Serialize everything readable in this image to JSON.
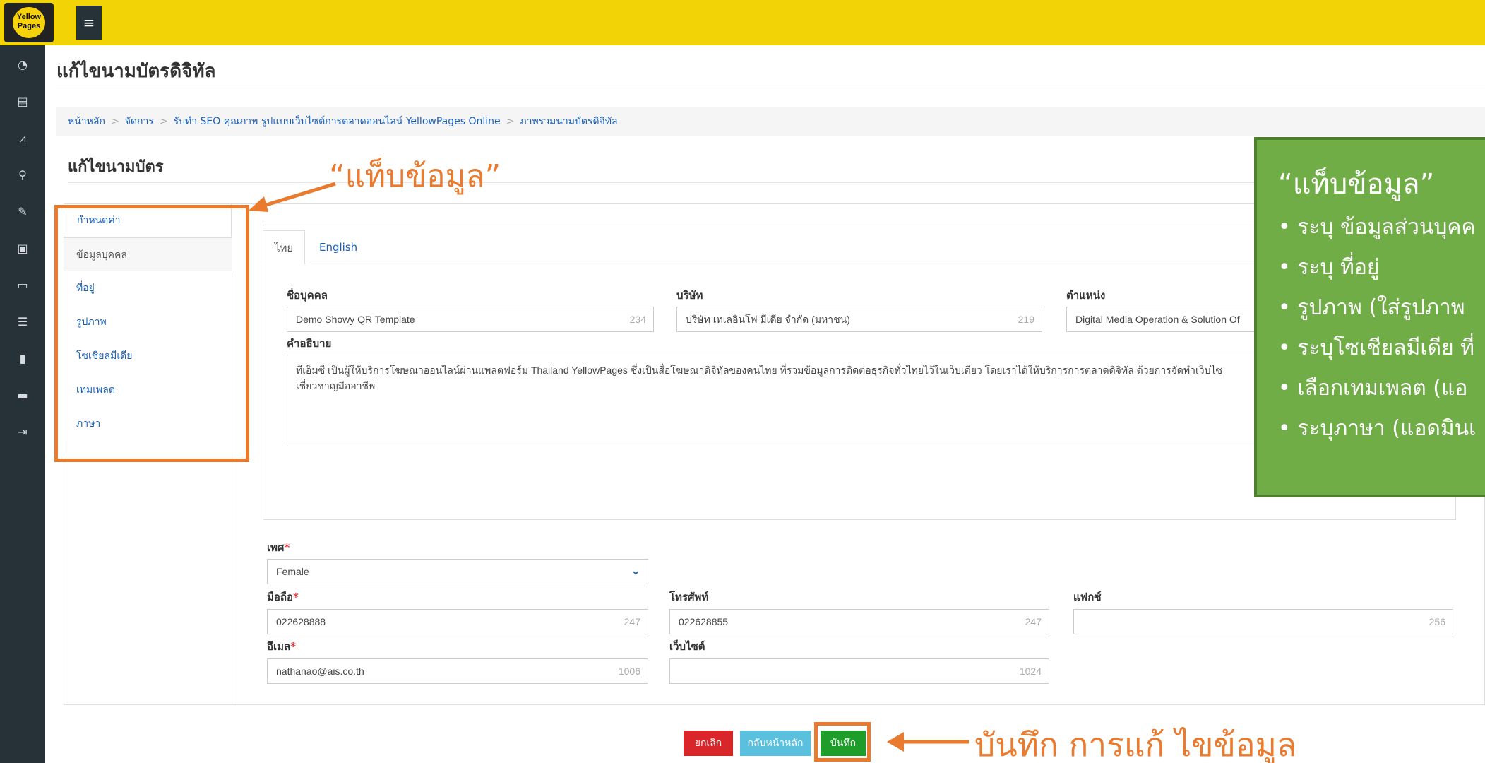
{
  "topbar": {
    "logo_text": "Yellow Pages",
    "menu_icon": "hamburger-icon"
  },
  "sidebar": {
    "icons": [
      "dashboard-icon",
      "database-icon",
      "chart-icon",
      "search-icon",
      "edit-icon",
      "card-icon",
      "id-card-icon",
      "list-icon",
      "clipboard-icon",
      "folder-icon",
      "sign-out-icon"
    ]
  },
  "page": {
    "title": "แก้ไขนามบัตรดิจิทัล"
  },
  "breadcrumb": {
    "items": [
      "หน้าหลัก",
      "จัดการ",
      "รับทำ SEO คุณภาพ รูปแบบเว็บไซต์การตลาดออนไลน์ YellowPages Online",
      "ภาพรวมนามบัตรดิจิทัล"
    ]
  },
  "card": {
    "title": "แก้ไขนามบัตร"
  },
  "vtabs": [
    "กำหนดค่า",
    "ข้อมูลบุคคล",
    "ที่อยู่",
    "รูปภาพ",
    "โซเชียลมีเดีย",
    "เทมเพลต",
    "ภาษา"
  ],
  "lang_tabs": [
    "ไทย",
    "English"
  ],
  "form": {
    "name": {
      "label": "ชื่อบุคคล",
      "value": "Demo Showy QR Template",
      "count": "234"
    },
    "company": {
      "label": "บริษัท",
      "value": "บริษัท เทเลอินโฟ มีเดีย จำกัด (มหาชน)",
      "count": "219"
    },
    "position": {
      "label": "ตำแหน่ง",
      "value": "Digital Media Operation & Solution Of"
    },
    "description": {
      "label": "คำอธิบาย",
      "value": "ทีเอ็มซี เป็นผู้ให้บริการโฆษณาออนไลน์ผ่านแพลตฟอร์ม Thailand YellowPages ซึ่งเป็นสื่อโฆษณาดิจิทัลของคนไทย ที่รวมข้อมูลการติดต่อธุรกิจทั่วไทยไว้ในเว็บเดียว โดยเราได้ให้บริการการตลาดดิจิทัล ด้วยการจัดทำเว็บไซ",
      "value2": "เชี่ยวชาญมืออาชีพ"
    },
    "gender": {
      "label": "เพศ",
      "value": "Female"
    },
    "mobile": {
      "label": "มือถือ",
      "value": "022628888",
      "count": "247"
    },
    "phone": {
      "label": "โทรศัพท์",
      "value": "022628855",
      "count": "247"
    },
    "fax": {
      "label": "แฟกซ์",
      "value": "",
      "count": "256"
    },
    "email": {
      "label": "อีเมล",
      "value": "nathanao@ais.co.th",
      "count": "1006"
    },
    "website": {
      "label": "เว็บไซต์",
      "value": "",
      "count": "1024"
    },
    "required_mark": "*"
  },
  "buttons": {
    "cancel": "ยกเลิก",
    "back": "กลับหน้าหลัก",
    "save": "บันทึก"
  },
  "annotations": {
    "tab_label": "“แท็บข้อมูล”",
    "save_label": "บันทึก การแก้ ไขข้อมูล",
    "green_title": "“แท็บข้อมูล”",
    "green_items": [
      "• ระบุ ข้อมูลส่วนบุคค",
      "• ระบุ ที่อยู่",
      "• รูปภาพ (ใส่รูปภาพ",
      "• ระบุโซเชียลมีเดีย ที่",
      "• เลือกเทมเพลต (แอ",
      "• ระบุภาษา (แอดมินเ"
    ],
    "accent_color": "#e97a2e",
    "green_color": "#70ad47"
  }
}
